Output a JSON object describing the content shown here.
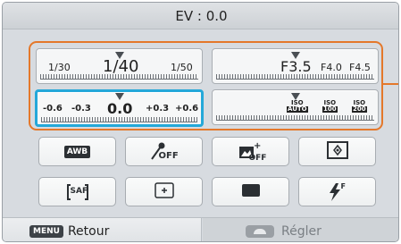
{
  "header": {
    "title": "EV : 0.0"
  },
  "shutter_dial": {
    "values": [
      "1/30",
      "1/40",
      "1/50"
    ]
  },
  "aperture_dial": {
    "values": [
      "F3.5",
      "F4.0",
      "F4.5"
    ]
  },
  "ev_dial": {
    "values": [
      "-0.6",
      "-0.3",
      "0.0",
      "+0.3",
      "+0.6"
    ]
  },
  "iso_dial": {
    "values": [
      "ISO AUTO",
      "ISO 100",
      "ISO 200"
    ],
    "labels_top": [
      "ISO",
      "ISO",
      "ISO"
    ],
    "labels_bottom": [
      "AUTO",
      "100",
      "200"
    ]
  },
  "settings_buttons": [
    {
      "id": "white-balance",
      "icon": "awb-icon",
      "label": "AWB"
    },
    {
      "id": "color",
      "icon": "color-dropper-off-icon",
      "label": "OFF"
    },
    {
      "id": "smart-filter",
      "icon": "smart-filter-off-icon",
      "label": "OFF"
    },
    {
      "id": "metering",
      "icon": "metering-icon"
    },
    {
      "id": "focus",
      "icon": "saf-icon",
      "label": "SAF"
    },
    {
      "id": "af-area",
      "icon": "focus-area-icon"
    },
    {
      "id": "aspect",
      "icon": "aspect-ratio-icon"
    },
    {
      "id": "flash",
      "icon": "flash-fill-icon",
      "label": "F"
    }
  ],
  "footer": {
    "menu_key": "MENU",
    "back_label": "Retour",
    "set_label": "Régler"
  },
  "colors": {
    "accent_orange": "#e4782b",
    "active_blue": "#24a8d9",
    "background": "#d7dbe0"
  }
}
